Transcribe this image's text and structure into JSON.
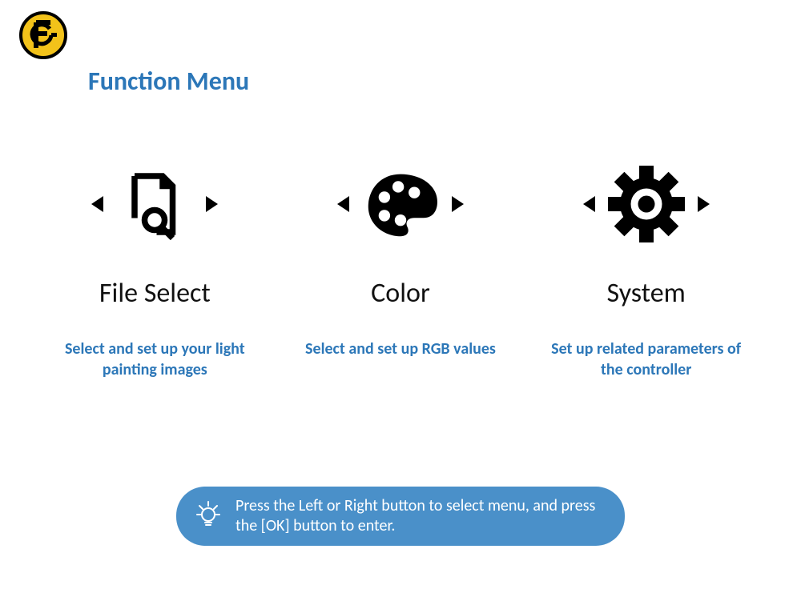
{
  "header": {
    "title": "Function Menu"
  },
  "items": [
    {
      "title": "File Select",
      "desc": "Select and set up your light painting images"
    },
    {
      "title": "Color",
      "desc": "Select and set up RGB values"
    },
    {
      "title": "System",
      "desc": "Set up related parameters of the controller"
    }
  ],
  "hint": {
    "text": "Press the Left or Right button to select menu, and press the [OK] button to enter."
  }
}
